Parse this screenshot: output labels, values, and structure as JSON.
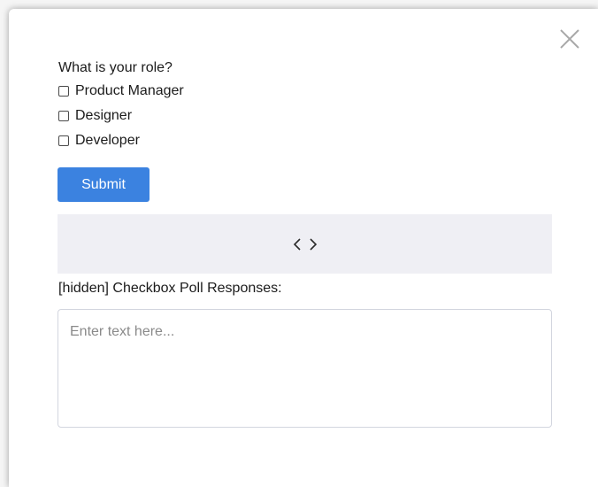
{
  "poll": {
    "question": "What is your role?",
    "options": [
      {
        "label": "Product Manager",
        "checked": false
      },
      {
        "label": "Designer",
        "checked": false
      },
      {
        "label": "Developer",
        "checked": false
      }
    ],
    "submit_label": "Submit"
  },
  "code_toggle": {
    "icon": "code-icon"
  },
  "responses": {
    "label": "[hidden] Checkbox Poll Responses:",
    "placeholder": "Enter text here...",
    "value": ""
  },
  "colors": {
    "accent": "#3b82e0",
    "code_bar_bg": "#efeff4"
  }
}
